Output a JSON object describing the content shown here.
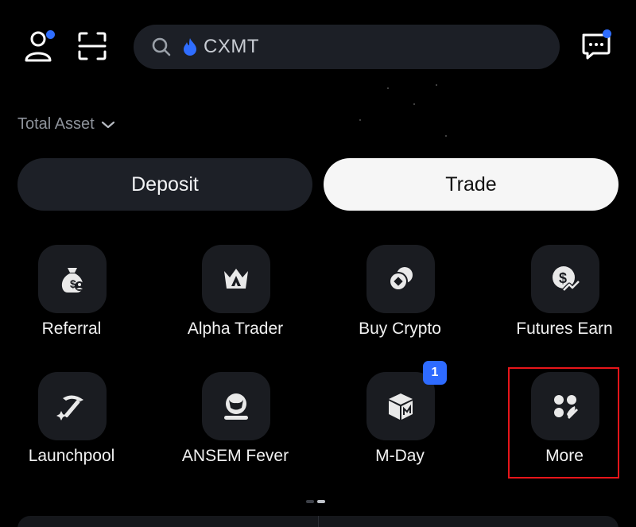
{
  "search": {
    "text": "CXMT"
  },
  "total_asset": {
    "label": "Total Asset"
  },
  "actions": {
    "deposit": "Deposit",
    "trade": "Trade"
  },
  "grid": [
    {
      "label": "Referral",
      "icon": "money-bag-icon"
    },
    {
      "label": "Alpha Trader",
      "icon": "alpha-crown-icon"
    },
    {
      "label": "Buy Crypto",
      "icon": "coin-icon"
    },
    {
      "label": "Futures Earn",
      "icon": "dollar-chart-icon"
    },
    {
      "label": "Launchpool",
      "icon": "pickaxe-icon"
    },
    {
      "label": "ANSEM Fever",
      "icon": "bull-icon"
    },
    {
      "label": "M-Day",
      "icon": "cube-m-icon",
      "badge": "1"
    },
    {
      "label": "More",
      "icon": "more-icon"
    }
  ],
  "colors": {
    "accent": "#2f6dff",
    "highlight": "#e8151a",
    "background": "#000000"
  }
}
